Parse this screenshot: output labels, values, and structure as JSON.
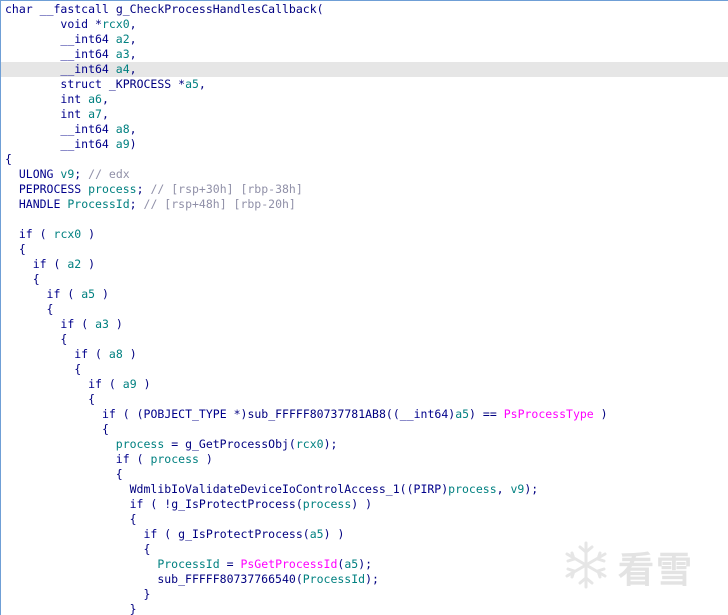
{
  "code": {
    "lines": [
      "char __fastcall g_CheckProcessHandlesCallback(",
      "        void *rcx0,",
      "        __int64 a2,",
      "        __int64 a3,",
      "        __int64 a4,",
      "        struct _KPROCESS *a5,",
      "        int a6,",
      "        int a7,",
      "        __int64 a8,",
      "        __int64 a9)",
      "{",
      "  ULONG v9; // edx",
      "  PEPROCESS process; // [rsp+30h] [rbp-38h]",
      "  HANDLE ProcessId; // [rsp+48h] [rbp-20h]",
      "",
      "  if ( rcx0 )",
      "  {",
      "    if ( a2 )",
      "    {",
      "      if ( a5 )",
      "      {",
      "        if ( a3 )",
      "        {",
      "          if ( a8 )",
      "          {",
      "            if ( a9 )",
      "            {",
      "              if ( (POBJECT_TYPE *)sub_FFFFF80737781AB8((__int64)a5) == PsProcessType )",
      "              {",
      "                process = g_GetProcessObj(rcx0);",
      "                if ( process )",
      "                {",
      "                  WdmlibIoValidateDeviceIoControlAccess_1((PIRP)process, v9);",
      "                  if ( !g_IsProtectProcess(process) )",
      "                  {",
      "                    if ( g_IsProtectProcess(a5) )",
      "                    {",
      "                      ProcessId = PsGetProcessId(a5);",
      "                      sub_FFFFF80737766540(ProcessId);",
      "                    }",
      "                  }"
    ],
    "highlighted_line": 4
  },
  "watermark": {
    "text": "看雪",
    "icon": "snowflake-icon"
  },
  "colors": {
    "keyword": "#00008b",
    "variable": "#008080",
    "comment": "#9090a8",
    "import": "#ff00ff",
    "highlight": "#e6e6e6"
  }
}
